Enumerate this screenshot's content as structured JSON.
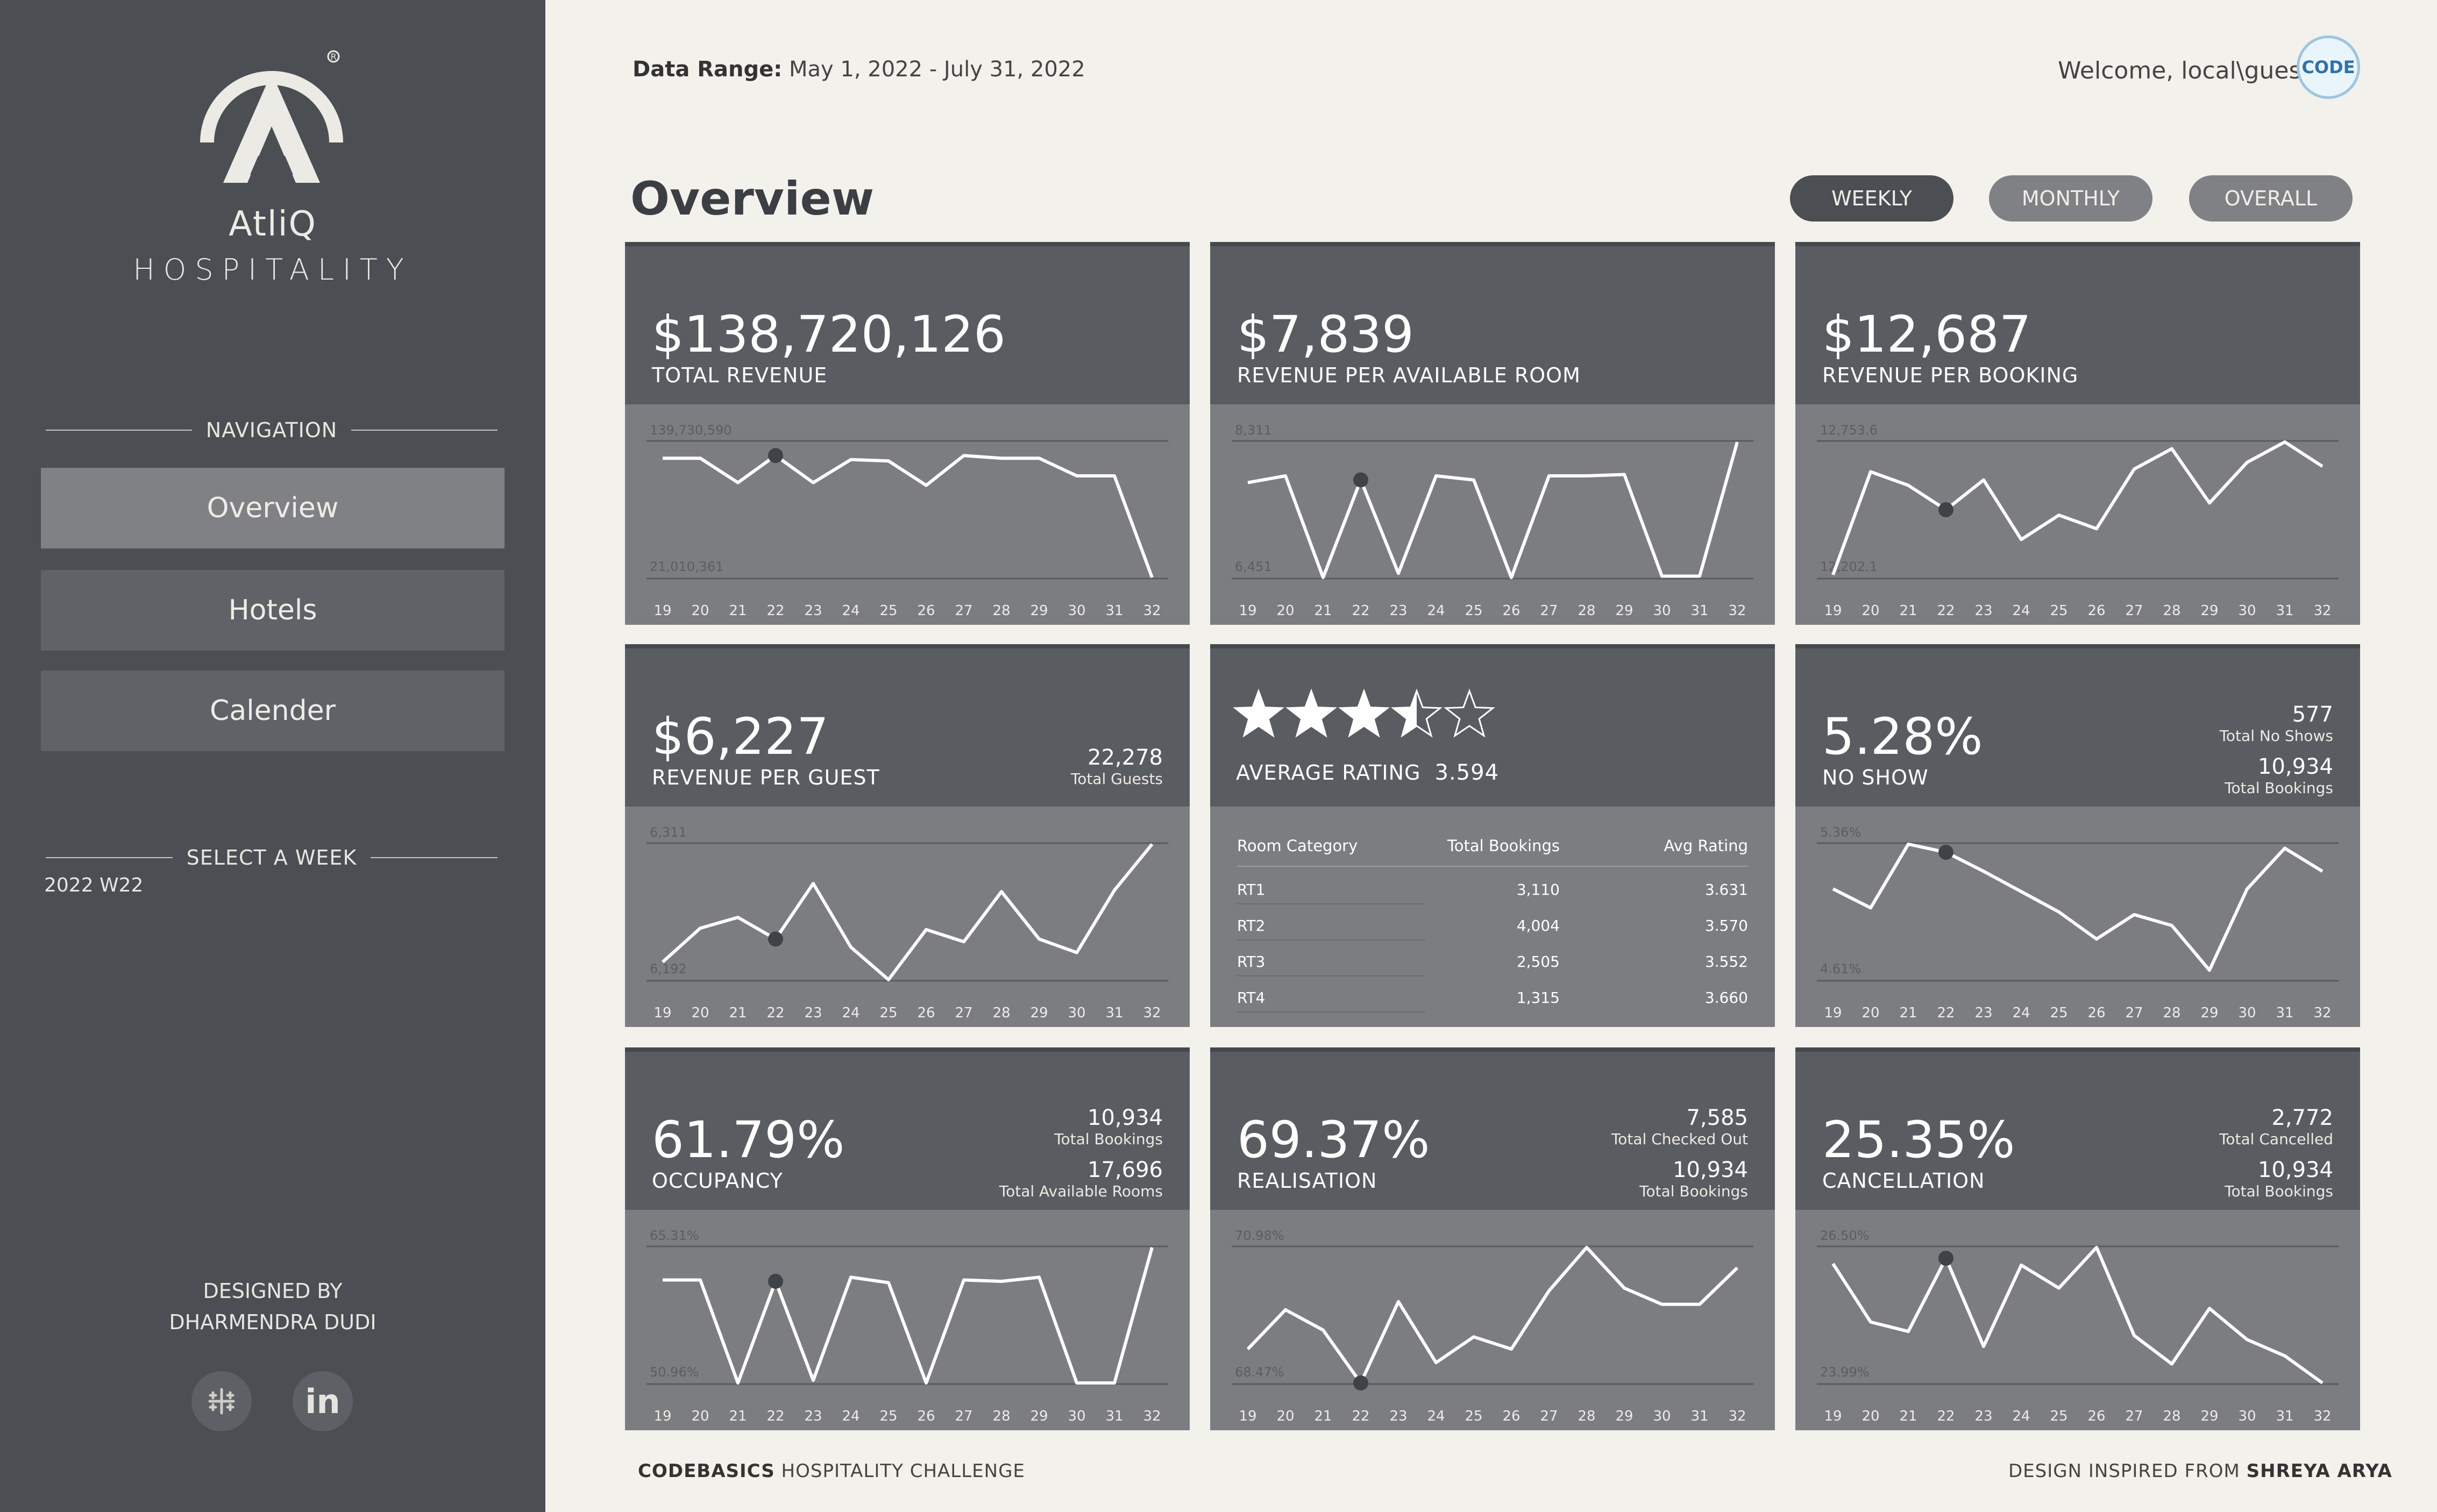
{
  "sidebar": {
    "brand_name": "AtliQ",
    "brand_sub": "HOSPITALITY",
    "nav_title": "NAVIGATION",
    "nav_items": [
      {
        "label": "Overview",
        "active": true
      },
      {
        "label": "Hotels",
        "active": false
      },
      {
        "label": "Calender",
        "active": false
      }
    ],
    "week_title": "SELECT A WEEK",
    "week_value": "2022 W22",
    "designed_line1": "DESIGNED BY",
    "designed_line2": "DHARMENDRA DUDI",
    "social": [
      {
        "icon": "tableau-icon"
      },
      {
        "icon": "linkedin-icon",
        "text": "in"
      }
    ]
  },
  "header": {
    "data_range_label": "Data Range:",
    "data_range_value": "May 1, 2022 - July 31, 2022",
    "welcome": "Welcome, local\\guest",
    "avatar_text": "CODE",
    "title": "Overview",
    "toggles": [
      {
        "label": "WEEKLY",
        "active": true
      },
      {
        "label": "MONTHLY",
        "active": false
      },
      {
        "label": "OVERALL",
        "active": false
      }
    ]
  },
  "weeks": [
    "19",
    "20",
    "21",
    "22",
    "23",
    "24",
    "25",
    "26",
    "27",
    "28",
    "29",
    "30",
    "31",
    "32"
  ],
  "cards": [
    {
      "value": "$138,720,126",
      "label": "TOTAL REVENUE",
      "ymax": "139,730,590",
      "ymin": "21,010,361",
      "marker": 3,
      "chart_data": {
        "type": "line",
        "x": [
          19,
          20,
          21,
          22,
          23,
          24,
          25,
          26,
          27,
          28,
          29,
          30,
          31,
          32
        ],
        "y": [
          0.88,
          0.88,
          0.7,
          0.9,
          0.7,
          0.87,
          0.86,
          0.68,
          0.9,
          0.88,
          0.88,
          0.75,
          0.75,
          0.0
        ]
      }
    },
    {
      "value": "$7,839",
      "label": "REVENUE PER AVAILABLE ROOM",
      "ymax": "8,311",
      "ymin": "6,451",
      "marker": 3,
      "chart_data": {
        "type": "line",
        "x": [
          19,
          20,
          21,
          22,
          23,
          24,
          25,
          26,
          27,
          28,
          29,
          30,
          31,
          32
        ],
        "y": [
          0.7,
          0.75,
          0.0,
          0.72,
          0.03,
          0.75,
          0.72,
          0.0,
          0.75,
          0.75,
          0.76,
          0.01,
          0.01,
          1.0
        ]
      }
    },
    {
      "value": "$12,687",
      "label": "REVENUE PER BOOKING",
      "ymax": "12,753.6",
      "ymin": "12,202.1",
      "marker": 3,
      "chart_data": {
        "type": "line",
        "x": [
          19,
          20,
          21,
          22,
          23,
          24,
          25,
          26,
          27,
          28,
          29,
          30,
          31,
          32
        ],
        "y": [
          0.02,
          0.78,
          0.68,
          0.5,
          0.72,
          0.28,
          0.46,
          0.36,
          0.8,
          0.95,
          0.55,
          0.85,
          1.0,
          0.82
        ]
      }
    },
    {
      "value": "$6,227",
      "label": "REVENUE PER GUEST",
      "stats": [
        {
          "v": "22,278",
          "c": "Total Guests"
        }
      ],
      "ymax": "6,311",
      "ymin": "6,192",
      "marker": 3,
      "chart_data": {
        "type": "line",
        "x": [
          19,
          20,
          21,
          22,
          23,
          24,
          25,
          26,
          27,
          28,
          29,
          30,
          31,
          32
        ],
        "y": [
          0.13,
          0.38,
          0.46,
          0.3,
          0.71,
          0.24,
          0.0,
          0.37,
          0.28,
          0.65,
          0.3,
          0.2,
          0.66,
          1.0
        ]
      }
    },
    {
      "type": "rating",
      "stars": 3.5,
      "label": "AVERAGE RATING",
      "value": "3.594",
      "table": {
        "headers": [
          "Room Category",
          "Total Bookings",
          "Avg Rating"
        ],
        "rows": [
          [
            "RT1",
            "3,110",
            "3.631"
          ],
          [
            "RT2",
            "4,004",
            "3.570"
          ],
          [
            "RT3",
            "2,505",
            "3.552"
          ],
          [
            "RT4",
            "1,315",
            "3.660"
          ]
        ]
      }
    },
    {
      "value": "5.28%",
      "label": "NO SHOW",
      "stats": [
        {
          "v": "577",
          "c": "Total No Shows"
        },
        {
          "v": "10,934",
          "c": "Total Bookings"
        }
      ],
      "ymax": "5.36%",
      "ymin": "4.61%",
      "marker": 3,
      "chart_data": {
        "type": "line",
        "x": [
          19,
          20,
          21,
          22,
          23,
          24,
          25,
          26,
          27,
          28,
          29,
          30,
          31,
          32
        ],
        "y": [
          0.67,
          0.53,
          1.0,
          0.94,
          0.8,
          0.65,
          0.5,
          0.3,
          0.48,
          0.4,
          0.07,
          0.67,
          0.97,
          0.8
        ]
      }
    },
    {
      "value": "61.79%",
      "label": "OCCUPANCY",
      "stats": [
        {
          "v": "10,934",
          "c": "Total Bookings"
        },
        {
          "v": "17,696",
          "c": "Total Available Rooms"
        }
      ],
      "ymax": "65.31%",
      "ymin": "50.96%",
      "marker": 3,
      "chart_data": {
        "type": "line",
        "x": [
          19,
          20,
          21,
          22,
          23,
          24,
          25,
          26,
          27,
          28,
          29,
          30,
          31,
          32
        ],
        "y": [
          0.76,
          0.76,
          0.0,
          0.75,
          0.02,
          0.78,
          0.74,
          0.0,
          0.76,
          0.75,
          0.78,
          0.0,
          0.0,
          1.0
        ]
      }
    },
    {
      "value": "69.37%",
      "label": "REALISATION",
      "stats": [
        {
          "v": "7,585",
          "c": "Total Checked Out"
        },
        {
          "v": "10,934",
          "c": "Total Bookings"
        }
      ],
      "ymax": "70.98%",
      "ymin": "68.47%",
      "marker": 3,
      "chart_data": {
        "type": "line",
        "x": [
          19,
          20,
          21,
          22,
          23,
          24,
          25,
          26,
          27,
          28,
          29,
          30,
          31,
          32
        ],
        "y": [
          0.25,
          0.54,
          0.39,
          0.0,
          0.6,
          0.15,
          0.34,
          0.25,
          0.68,
          1.0,
          0.7,
          0.58,
          0.58,
          0.85
        ]
      }
    },
    {
      "value": "25.35%",
      "label": "CANCELLATION",
      "stats": [
        {
          "v": "2,772",
          "c": "Total Cancelled"
        },
        {
          "v": "10,934",
          "c": "Total Bookings"
        }
      ],
      "ymax": "26.50%",
      "ymin": "23.99%",
      "marker": 3,
      "chart_data": {
        "type": "line",
        "x": [
          19,
          20,
          21,
          22,
          23,
          24,
          25,
          26,
          27,
          28,
          29,
          30,
          31,
          32
        ],
        "y": [
          0.88,
          0.45,
          0.38,
          0.92,
          0.27,
          0.87,
          0.7,
          1.0,
          0.35,
          0.14,
          0.55,
          0.32,
          0.2,
          0.0
        ]
      }
    }
  ],
  "footer": {
    "left_bold": "CODEBASICS",
    "left_rest": " HOSPITALITY CHALLENGE",
    "right_rest": "DESIGN INSPIRED FROM ",
    "right_bold": "SHREYA ARYA"
  }
}
